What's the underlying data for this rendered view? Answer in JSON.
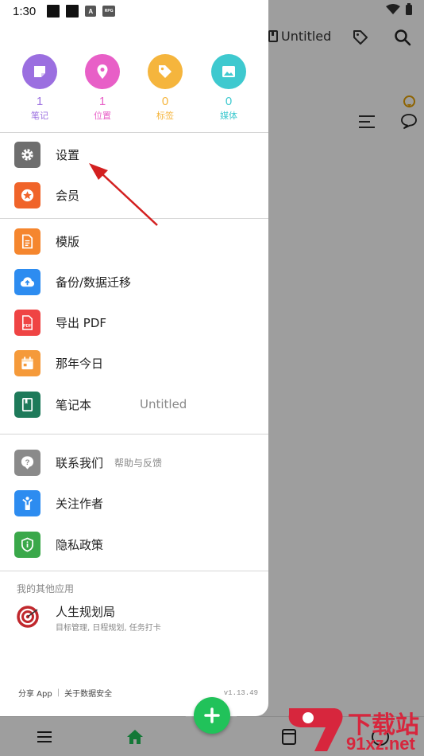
{
  "status_bar": {
    "time": "1:30",
    "icon_a": "A",
    "icon_b": "RPG"
  },
  "background": {
    "notebook_title": "Untitled",
    "icons": [
      "notebook-icon",
      "tag-icon",
      "search-icon",
      "smile-icon",
      "menu-icon",
      "comment-icon"
    ]
  },
  "stats": [
    {
      "value": "1",
      "label": "笔记",
      "color": "#9b6fe0",
      "icon": "note-icon"
    },
    {
      "value": "1",
      "label": "位置",
      "color": "#e85fc7",
      "icon": "location-pin-icon"
    },
    {
      "value": "0",
      "label": "标签",
      "color": "#f5b53d",
      "icon": "tag-icon"
    },
    {
      "value": "0",
      "label": "媒体",
      "color": "#3ec9cf",
      "icon": "image-icon"
    }
  ],
  "menu": {
    "settings": {
      "label": "设置",
      "color": "#6e6e6e",
      "icon": "gear-icon"
    },
    "member": {
      "label": "会员",
      "color": "#f0642a",
      "icon": "star-badge-icon"
    },
    "template": {
      "label": "模版",
      "color": "#f5862e",
      "icon": "document-icon"
    },
    "backup": {
      "label": "备份/数据迁移",
      "color": "#2d8cf0",
      "icon": "cloud-upload-icon"
    },
    "export_pdf": {
      "label": "导出 PDF",
      "color": "#ef4444",
      "icon": "pdf-icon"
    },
    "on_this_day": {
      "label": "那年今日",
      "color": "#f59a3a",
      "icon": "calendar-icon"
    },
    "notebook": {
      "label": "笔记本",
      "value": "Untitled",
      "color": "#1e7a5a",
      "icon": "notebook-icon"
    },
    "contact": {
      "label": "联系我们",
      "sub": "帮助与反馈",
      "color": "#8a8a8a",
      "icon": "question-icon"
    },
    "follow": {
      "label": "关注作者",
      "color": "#2d8cf0",
      "icon": "person-icon"
    },
    "privacy": {
      "label": "隐私政策",
      "color": "#3aa84a",
      "icon": "shield-icon"
    }
  },
  "other_apps": {
    "title": "我的其他应用",
    "items": [
      {
        "name": "人生规划局",
        "desc": "目标管理, 日程规划, 任务打卡",
        "icon": "target-icon"
      }
    ]
  },
  "footer": {
    "share": "分享 App",
    "security": "关于数据安全",
    "version": "v1.13.49"
  },
  "bottom_nav": {
    "icons": [
      "menu-icon",
      "home-icon",
      "calendar-icon",
      "history-icon"
    ],
    "accent": "#21c25a"
  },
  "watermark": {
    "top": "下载站",
    "bottom": "91xz.net"
  }
}
